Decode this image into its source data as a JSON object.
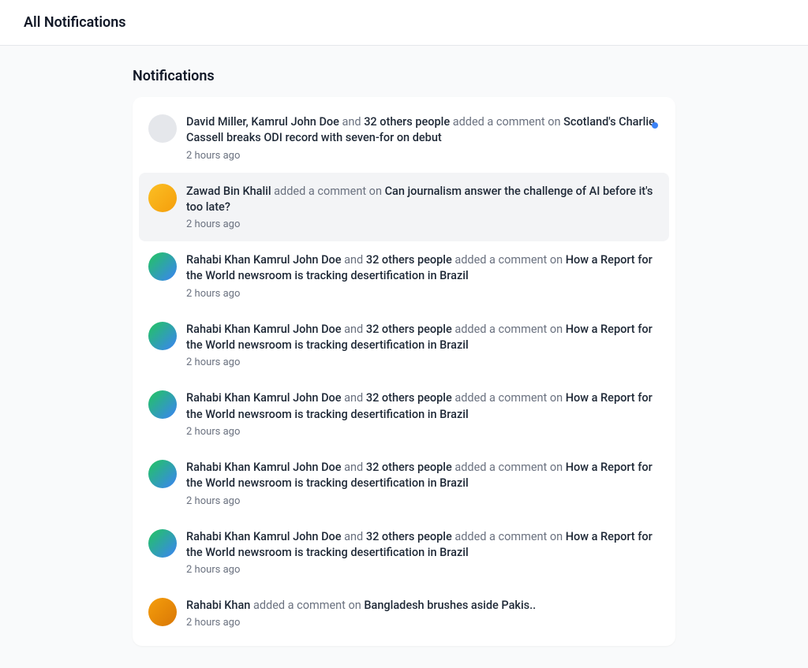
{
  "header": {
    "title": "All Notifications"
  },
  "section": {
    "title": "Notifications"
  },
  "notifications": [
    {
      "actor": "David Miller, Kamrul John Doe",
      "connector": " and ",
      "extra": "32 others people",
      "action": " added a comment on ",
      "target": "Scotland's Charlie Cassell breaks ODI record with seven-for on debut",
      "time": "2 hours ago",
      "avatarClass": "avatar-1",
      "unread": true,
      "selected": false
    },
    {
      "actor": "Zawad Bin Khalil",
      "connector": "",
      "extra": "",
      "action": " added a comment on ",
      "target": "Can journalism answer the challenge of AI before it's too late?",
      "time": "2 hours ago",
      "avatarClass": "avatar-2",
      "unread": false,
      "selected": true
    },
    {
      "actor": "Rahabi Khan Kamrul John Doe",
      "connector": " and ",
      "extra": "32 others people",
      "action": " added a comment on ",
      "target": "How a Report for the World newsroom is tracking desertification in Brazil",
      "time": "2 hours ago",
      "avatarClass": "avatar-3",
      "unread": false,
      "selected": false
    },
    {
      "actor": "Rahabi Khan Kamrul John Doe",
      "connector": " and ",
      "extra": "32 others people",
      "action": " added a comment on ",
      "target": "How a Report for the World newsroom is tracking desertification in Brazil",
      "time": "2 hours ago",
      "avatarClass": "avatar-3",
      "unread": false,
      "selected": false
    },
    {
      "actor": "Rahabi Khan Kamrul John Doe",
      "connector": " and ",
      "extra": "32 others people",
      "action": " added a comment on ",
      "target": "How a Report for the World newsroom is tracking desertification in Brazil",
      "time": "2 hours ago",
      "avatarClass": "avatar-3",
      "unread": false,
      "selected": false
    },
    {
      "actor": "Rahabi Khan Kamrul John Doe",
      "connector": " and ",
      "extra": "32 others people",
      "action": " added a comment on ",
      "target": "How a Report for the World newsroom is tracking desertification in Brazil",
      "time": "2 hours ago",
      "avatarClass": "avatar-3",
      "unread": false,
      "selected": false
    },
    {
      "actor": "Rahabi Khan Kamrul John Doe",
      "connector": " and ",
      "extra": "32 others people",
      "action": " added a comment on ",
      "target": "How a Report for the World newsroom is tracking desertification in Brazil",
      "time": "2 hours ago",
      "avatarClass": "avatar-3",
      "unread": false,
      "selected": false
    },
    {
      "actor": "Rahabi Khan",
      "connector": "",
      "extra": "",
      "action": " added a comment on ",
      "target": "Bangladesh brushes aside Pakis..",
      "time": "2 hours ago",
      "avatarClass": "avatar-4",
      "unread": false,
      "selected": false
    }
  ]
}
